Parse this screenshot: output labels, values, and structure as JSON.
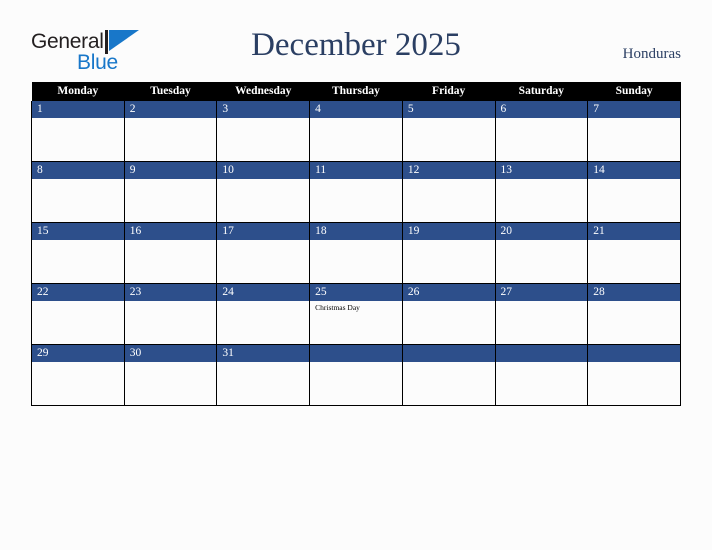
{
  "brand": {
    "name_part1": "General",
    "name_part2": "Blue",
    "flag_icon": "flag-triangle-icon",
    "color_dark": "#231f20",
    "color_blue": "#1877c9"
  },
  "header": {
    "title": "December 2025",
    "country": "Honduras",
    "title_color": "#2b3f63"
  },
  "calendar": {
    "weekday_headers": [
      "Monday",
      "Tuesday",
      "Wednesday",
      "Thursday",
      "Friday",
      "Saturday",
      "Sunday"
    ],
    "header_bg": "#000000",
    "header_text_color": "#ffffff",
    "daybar_bg": "#2d4f8b",
    "daybar_text_color": "#ffffff",
    "cell_bg": "#fcfcfc",
    "border_color": "#000000",
    "weeks": [
      [
        {
          "day": "1",
          "events": []
        },
        {
          "day": "2",
          "events": []
        },
        {
          "day": "3",
          "events": []
        },
        {
          "day": "4",
          "events": []
        },
        {
          "day": "5",
          "events": []
        },
        {
          "day": "6",
          "events": []
        },
        {
          "day": "7",
          "events": []
        }
      ],
      [
        {
          "day": "8",
          "events": []
        },
        {
          "day": "9",
          "events": []
        },
        {
          "day": "10",
          "events": []
        },
        {
          "day": "11",
          "events": []
        },
        {
          "day": "12",
          "events": []
        },
        {
          "day": "13",
          "events": []
        },
        {
          "day": "14",
          "events": []
        }
      ],
      [
        {
          "day": "15",
          "events": []
        },
        {
          "day": "16",
          "events": []
        },
        {
          "day": "17",
          "events": []
        },
        {
          "day": "18",
          "events": []
        },
        {
          "day": "19",
          "events": []
        },
        {
          "day": "20",
          "events": []
        },
        {
          "day": "21",
          "events": []
        }
      ],
      [
        {
          "day": "22",
          "events": []
        },
        {
          "day": "23",
          "events": []
        },
        {
          "day": "24",
          "events": []
        },
        {
          "day": "25",
          "events": [
            "Christmas Day"
          ]
        },
        {
          "day": "26",
          "events": []
        },
        {
          "day": "27",
          "events": []
        },
        {
          "day": "28",
          "events": []
        }
      ],
      [
        {
          "day": "29",
          "events": []
        },
        {
          "day": "30",
          "events": []
        },
        {
          "day": "31",
          "events": []
        },
        {
          "day": "",
          "events": []
        },
        {
          "day": "",
          "events": []
        },
        {
          "day": "",
          "events": []
        },
        {
          "day": "",
          "events": []
        }
      ]
    ]
  }
}
